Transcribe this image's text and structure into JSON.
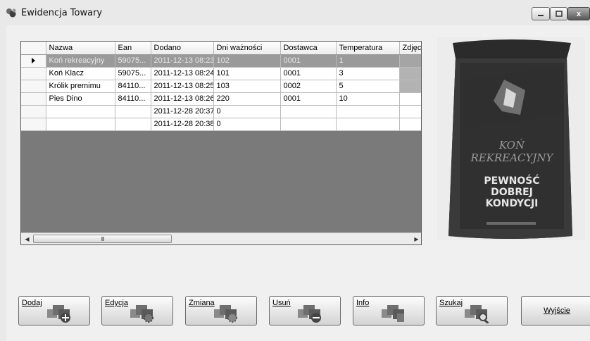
{
  "window": {
    "title": "Ewidencja Towary",
    "controls": {
      "close": "x"
    }
  },
  "grid": {
    "columns": [
      "Nazwa",
      "Ean",
      "Dodano",
      "Dni ważności",
      "Dostawca",
      "Temperatura",
      "Zdjęcie"
    ],
    "rows": [
      {
        "nazwa": "Koń rekreacyjny",
        "ean": "59075...",
        "dodano": "2011-12-13 08:23",
        "dni": "102",
        "dostawca": "0001",
        "temperatura": "1"
      },
      {
        "nazwa": "Koń Klacz",
        "ean": "59075...",
        "dodano": "2011-12-13 08:24",
        "dni": "101",
        "dostawca": "0001",
        "temperatura": "3"
      },
      {
        "nazwa": "Królik premimu",
        "ean": "84110...",
        "dodano": "2011-12-13 08:25",
        "dni": "103",
        "dostawca": "0002",
        "temperatura": "5"
      },
      {
        "nazwa": "Pies Dino",
        "ean": "84110...",
        "dodano": "2011-12-13 08:26",
        "dni": "220",
        "dostawca": "0001",
        "temperatura": "10"
      },
      {
        "nazwa": "",
        "ean": "",
        "dodano": "2011-12-28 20:37",
        "dni": "0",
        "dostawca": "",
        "temperatura": ""
      },
      {
        "nazwa": "",
        "ean": "",
        "dodano": "2011-12-28 20:38",
        "dni": "0",
        "dostawca": "",
        "temperatura": ""
      }
    ],
    "selected_row": 0,
    "scroll_thumb_grip": "III"
  },
  "product_image": {
    "brand": "KOŃ REKREACYJNY",
    "slogan": [
      "PEWNOŚĆ",
      "DOBREJ",
      "KONDYCJI"
    ]
  },
  "buttons": {
    "dodaj": "Dodaj",
    "edycja": "Edycja",
    "zmiana": "Zmiana",
    "usun": "Usuń",
    "info": "Info",
    "szukaj": "Szukaj",
    "wyjscie": "Wyjście"
  }
}
